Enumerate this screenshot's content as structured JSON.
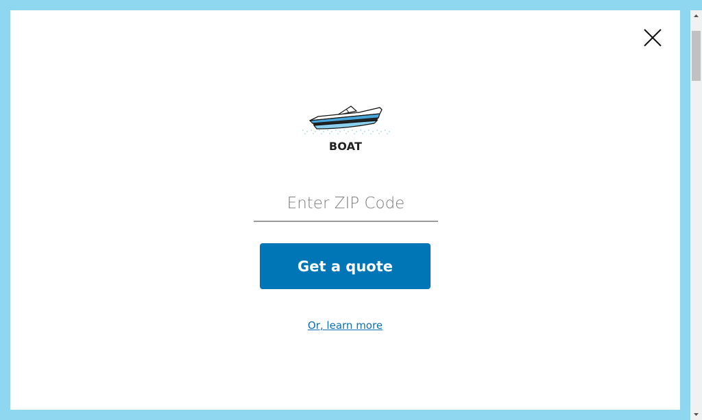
{
  "colors": {
    "backdrop": "#8fd7f1",
    "modal_background": "#ffffff",
    "primary_button": "#0076b6",
    "link": "#0d6fb3"
  },
  "modal": {
    "close_icon": "close-icon",
    "product": {
      "icon": "boat-icon",
      "label": "BOAT"
    },
    "zip": {
      "value": "",
      "placeholder": "Enter ZIP Code"
    },
    "quote_button_label": "Get a quote",
    "learn_more_label": "Or, learn more"
  },
  "scrollbar": {
    "position": 0.0
  }
}
